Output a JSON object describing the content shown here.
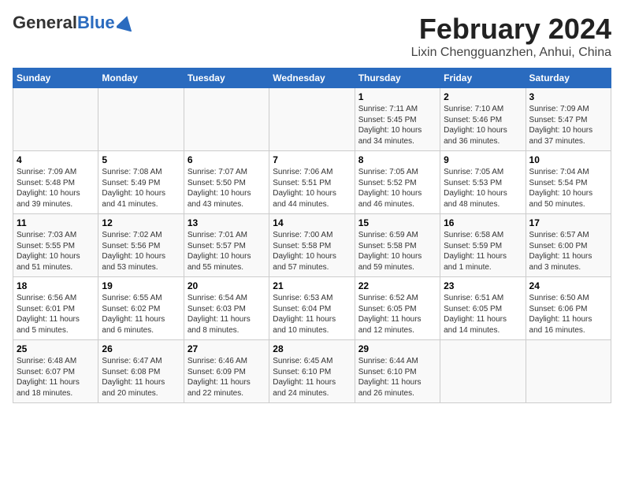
{
  "header": {
    "logo_general": "General",
    "logo_blue": "Blue",
    "title": "February 2024",
    "subtitle": "Lixin Chengguanzhen, Anhui, China"
  },
  "weekdays": [
    "Sunday",
    "Monday",
    "Tuesday",
    "Wednesday",
    "Thursday",
    "Friday",
    "Saturday"
  ],
  "weeks": [
    [
      {
        "day": "",
        "detail": ""
      },
      {
        "day": "",
        "detail": ""
      },
      {
        "day": "",
        "detail": ""
      },
      {
        "day": "",
        "detail": ""
      },
      {
        "day": "1",
        "detail": "Sunrise: 7:11 AM\nSunset: 5:45 PM\nDaylight: 10 hours\nand 34 minutes."
      },
      {
        "day": "2",
        "detail": "Sunrise: 7:10 AM\nSunset: 5:46 PM\nDaylight: 10 hours\nand 36 minutes."
      },
      {
        "day": "3",
        "detail": "Sunrise: 7:09 AM\nSunset: 5:47 PM\nDaylight: 10 hours\nand 37 minutes."
      }
    ],
    [
      {
        "day": "4",
        "detail": "Sunrise: 7:09 AM\nSunset: 5:48 PM\nDaylight: 10 hours\nand 39 minutes."
      },
      {
        "day": "5",
        "detail": "Sunrise: 7:08 AM\nSunset: 5:49 PM\nDaylight: 10 hours\nand 41 minutes."
      },
      {
        "day": "6",
        "detail": "Sunrise: 7:07 AM\nSunset: 5:50 PM\nDaylight: 10 hours\nand 43 minutes."
      },
      {
        "day": "7",
        "detail": "Sunrise: 7:06 AM\nSunset: 5:51 PM\nDaylight: 10 hours\nand 44 minutes."
      },
      {
        "day": "8",
        "detail": "Sunrise: 7:05 AM\nSunset: 5:52 PM\nDaylight: 10 hours\nand 46 minutes."
      },
      {
        "day": "9",
        "detail": "Sunrise: 7:05 AM\nSunset: 5:53 PM\nDaylight: 10 hours\nand 48 minutes."
      },
      {
        "day": "10",
        "detail": "Sunrise: 7:04 AM\nSunset: 5:54 PM\nDaylight: 10 hours\nand 50 minutes."
      }
    ],
    [
      {
        "day": "11",
        "detail": "Sunrise: 7:03 AM\nSunset: 5:55 PM\nDaylight: 10 hours\nand 51 minutes."
      },
      {
        "day": "12",
        "detail": "Sunrise: 7:02 AM\nSunset: 5:56 PM\nDaylight: 10 hours\nand 53 minutes."
      },
      {
        "day": "13",
        "detail": "Sunrise: 7:01 AM\nSunset: 5:57 PM\nDaylight: 10 hours\nand 55 minutes."
      },
      {
        "day": "14",
        "detail": "Sunrise: 7:00 AM\nSunset: 5:58 PM\nDaylight: 10 hours\nand 57 minutes."
      },
      {
        "day": "15",
        "detail": "Sunrise: 6:59 AM\nSunset: 5:58 PM\nDaylight: 10 hours\nand 59 minutes."
      },
      {
        "day": "16",
        "detail": "Sunrise: 6:58 AM\nSunset: 5:59 PM\nDaylight: 11 hours\nand 1 minute."
      },
      {
        "day": "17",
        "detail": "Sunrise: 6:57 AM\nSunset: 6:00 PM\nDaylight: 11 hours\nand 3 minutes."
      }
    ],
    [
      {
        "day": "18",
        "detail": "Sunrise: 6:56 AM\nSunset: 6:01 PM\nDaylight: 11 hours\nand 5 minutes."
      },
      {
        "day": "19",
        "detail": "Sunrise: 6:55 AM\nSunset: 6:02 PM\nDaylight: 11 hours\nand 6 minutes."
      },
      {
        "day": "20",
        "detail": "Sunrise: 6:54 AM\nSunset: 6:03 PM\nDaylight: 11 hours\nand 8 minutes."
      },
      {
        "day": "21",
        "detail": "Sunrise: 6:53 AM\nSunset: 6:04 PM\nDaylight: 11 hours\nand 10 minutes."
      },
      {
        "day": "22",
        "detail": "Sunrise: 6:52 AM\nSunset: 6:05 PM\nDaylight: 11 hours\nand 12 minutes."
      },
      {
        "day": "23",
        "detail": "Sunrise: 6:51 AM\nSunset: 6:05 PM\nDaylight: 11 hours\nand 14 minutes."
      },
      {
        "day": "24",
        "detail": "Sunrise: 6:50 AM\nSunset: 6:06 PM\nDaylight: 11 hours\nand 16 minutes."
      }
    ],
    [
      {
        "day": "25",
        "detail": "Sunrise: 6:48 AM\nSunset: 6:07 PM\nDaylight: 11 hours\nand 18 minutes."
      },
      {
        "day": "26",
        "detail": "Sunrise: 6:47 AM\nSunset: 6:08 PM\nDaylight: 11 hours\nand 20 minutes."
      },
      {
        "day": "27",
        "detail": "Sunrise: 6:46 AM\nSunset: 6:09 PM\nDaylight: 11 hours\nand 22 minutes."
      },
      {
        "day": "28",
        "detail": "Sunrise: 6:45 AM\nSunset: 6:10 PM\nDaylight: 11 hours\nand 24 minutes."
      },
      {
        "day": "29",
        "detail": "Sunrise: 6:44 AM\nSunset: 6:10 PM\nDaylight: 11 hours\nand 26 minutes."
      },
      {
        "day": "",
        "detail": ""
      },
      {
        "day": "",
        "detail": ""
      }
    ]
  ]
}
